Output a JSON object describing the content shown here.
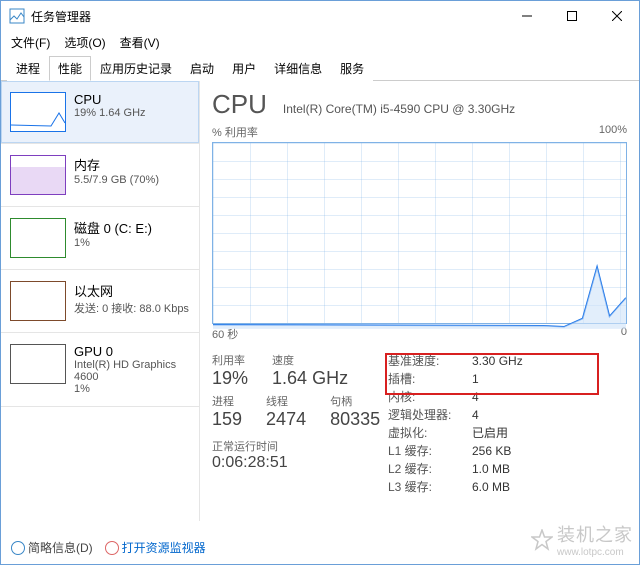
{
  "window": {
    "title": "任务管理器"
  },
  "menu": {
    "file": "文件(F)",
    "options": "选项(O)",
    "view": "查看(V)"
  },
  "tabs": [
    "进程",
    "性能",
    "应用历史记录",
    "启动",
    "用户",
    "详细信息",
    "服务"
  ],
  "sidebar": {
    "items": [
      {
        "name": "CPU",
        "sub": "19% 1.64 GHz"
      },
      {
        "name": "内存",
        "sub": "5.5/7.9 GB (70%)"
      },
      {
        "name": "磁盘 0 (C: E:)",
        "sub": "1%"
      },
      {
        "name": "以太网",
        "sub": "发送: 0 接收: 88.0 Kbps"
      },
      {
        "name": "GPU 0",
        "sub": "Intel(R) HD Graphics 4600",
        "sub2": "1%"
      }
    ]
  },
  "main": {
    "heading": "CPU",
    "model": "Intel(R) Core(TM) i5-4590 CPU @ 3.30GHz",
    "topLeft": "% 利用率",
    "topRight": "100%",
    "xLeft": "60 秒",
    "xRight": "0",
    "leftStats": [
      [
        {
          "label": "利用率",
          "val": "19%"
        },
        {
          "label": "速度",
          "val": "1.64 GHz"
        }
      ],
      [
        {
          "label": "进程",
          "val": "159"
        },
        {
          "label": "线程",
          "val": "2474"
        },
        {
          "label": "句柄",
          "val": "80335"
        }
      ]
    ],
    "uptimeLabel": "正常运行时间",
    "uptime": "0:06:28:51",
    "rightStats": [
      {
        "k": "基准速度:",
        "v": "3.30 GHz"
      },
      {
        "k": "插槽:",
        "v": "1"
      },
      {
        "k": "内核:",
        "v": "4"
      },
      {
        "k": "逻辑处理器:",
        "v": "4"
      },
      {
        "k": "虚拟化:",
        "v": "已启用"
      },
      {
        "k": "L1 缓存:",
        "v": "256 KB"
      },
      {
        "k": "L2 缓存:",
        "v": "1.0 MB"
      },
      {
        "k": "L3 缓存:",
        "v": "6.0 MB"
      }
    ]
  },
  "footer": {
    "less": "简略信息(D)",
    "link": "打开资源监视器"
  },
  "watermark": {
    "text": "装机之家",
    "url": "www.lotpc.com"
  },
  "chart_data": {
    "type": "line",
    "title": "% 利用率",
    "xlabel": "60 秒 → 0",
    "ylabel": "%",
    "ylim": [
      0,
      100
    ],
    "x_seconds_ago": [
      60,
      55,
      50,
      45,
      40,
      35,
      30,
      25,
      20,
      15,
      10,
      5,
      0
    ],
    "values": [
      1,
      1,
      1,
      1,
      1,
      1,
      1,
      1,
      1,
      1,
      5,
      30,
      15
    ]
  }
}
